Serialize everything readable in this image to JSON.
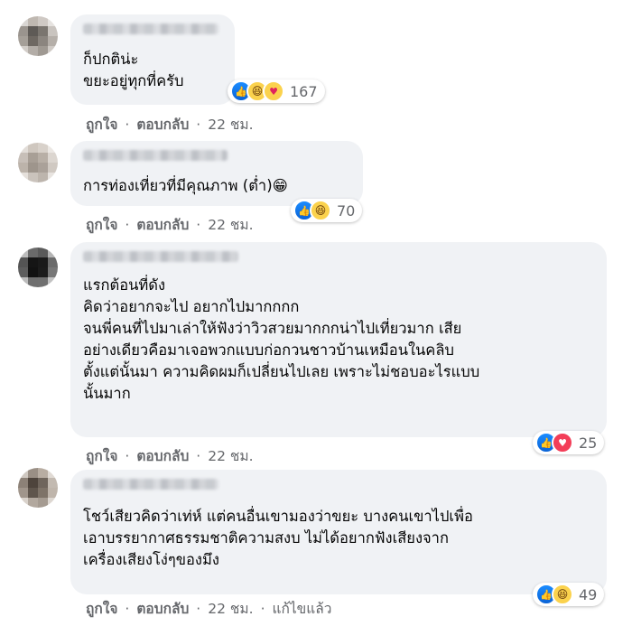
{
  "comments": [
    {
      "text": "ก็ปกติน่ะ\nขยะอยู่ทุกที่ครับ",
      "reactions": {
        "types": [
          "like",
          "haha",
          "care"
        ],
        "count": "167"
      },
      "actions": {
        "like": "ถูกใจ",
        "reply": "ตอบกลับ",
        "time": "22 ชม.",
        "edited": ""
      }
    },
    {
      "text": "การท่องเที่ยวที่มีคุณภาพ (ต่ำ)😁",
      "reactions": {
        "types": [
          "like",
          "haha"
        ],
        "count": "70"
      },
      "actions": {
        "like": "ถูกใจ",
        "reply": "ตอบกลับ",
        "time": "22 ชม.",
        "edited": ""
      }
    },
    {
      "text": "แรกต้อนที่ดัง\nคิดว่าอยากจะไป อยากไปมากกกก\nจนพี่คนที่ไปมาเล่าให้ฟังว่าวิวสวยมากกกน่าไปเที่ยวมาก เสีย\nอย่างเดียวคือมาเจอพวกแบบก่อกวนชาวบ้านเหมือนในคลิบ\nตั้งแต่นั้นมา ความคิดผมก็เปลี่ยนไปเลย เพราะไม่ชอบอะไรแบบ\nนั้นมาก",
      "reactions": {
        "types": [
          "like",
          "love"
        ],
        "count": "25"
      },
      "actions": {
        "like": "ถูกใจ",
        "reply": "ตอบกลับ",
        "time": "22 ชม.",
        "edited": ""
      }
    },
    {
      "text": "โชว์เสียวคิดว่าเท่ห์ แต่คนอื่นเขามองว่าขยะ บางคนเขาไปเพื่อ\nเอาบรรยากาศธรรมชาติความสงบ ไม่ได้อยากฟังเสียงจาก\nเครื่องเสียงโง่ๆของมึง",
      "reactions": {
        "types": [
          "like",
          "haha"
        ],
        "count": "49"
      },
      "actions": {
        "like": "ถูกใจ",
        "reply": "ตอบกลับ",
        "time": "22 ชม.",
        "edited": "แก้ไขแล้ว"
      }
    }
  ],
  "icons": {
    "like": "thumbs-up-icon",
    "haha": "haha-emoji-icon",
    "love": "heart-icon",
    "care": "care-emoji-icon"
  },
  "colors": {
    "bubble": "#f0f2f5",
    "meta": "#65676b",
    "like_blue": "#1877f2",
    "love_red": "#f33e58"
  }
}
